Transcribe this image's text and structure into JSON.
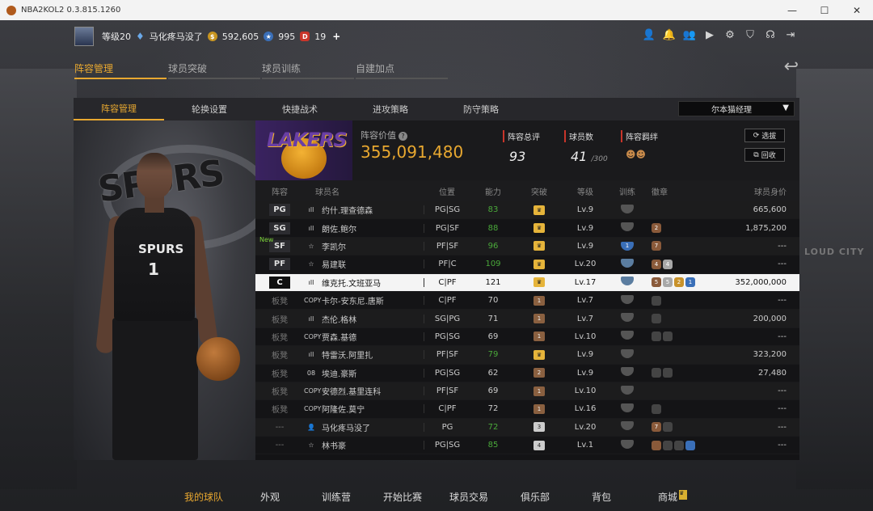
{
  "window": {
    "title": "NBA2KOL2 0.3.815.1260",
    "controls": [
      "—",
      "☐",
      "✕"
    ]
  },
  "topbar": {
    "level": "等级20",
    "username": "马化疼马没了",
    "gold": "592,605",
    "stars": "995",
    "tickets": "19",
    "plus": "+"
  },
  "main_tabs": [
    "阵容管理",
    "球员突破",
    "球员训练",
    "自建加点"
  ],
  "sub_tabs": [
    "阵容管理",
    "轮换设置",
    "快捷战术",
    "进攻策略",
    "防守策略"
  ],
  "manager_select": "尔本猫经理",
  "summary": {
    "lineup_value_label": "阵容价值",
    "lineup_value": "355,091,480",
    "rating_label": "阵容总评",
    "rating": "93",
    "players_label": "球员数",
    "players": "41",
    "players_max": "/300",
    "bond_label": "阵容羁绊",
    "btn_select": "选拔",
    "btn_recycle": "回收"
  },
  "columns": [
    "阵容",
    "球员名",
    "位置",
    "能力",
    "突破",
    "等级",
    "训练",
    "徽章",
    "球员身价"
  ],
  "rows": [
    {
      "slot": "PG",
      "tag": "",
      "icon": "ıll",
      "name": "约什.理查德森",
      "role": "PG|SG",
      "ovr": "83",
      "green": true,
      "brk": "gold",
      "brk_text": "♛",
      "lv": "Lv.9",
      "train": "",
      "badges": [],
      "val": "665,600",
      "hl": false
    },
    {
      "slot": "SG",
      "tag": "",
      "icon": "ıll",
      "name": "朗佐.鲍尔",
      "role": "PG|SF",
      "ovr": "88",
      "green": true,
      "brk": "gold",
      "brk_text": "♛",
      "lv": "Lv.9",
      "train": "",
      "badges": [
        "br:2"
      ],
      "val": "1,875,200",
      "hl": false
    },
    {
      "slot": "SF",
      "tag": "New",
      "icon": "☆",
      "name": "李凯尔",
      "role": "PF|SF",
      "ovr": "96",
      "green": true,
      "brk": "gold",
      "brk_text": "♛",
      "lv": "Lv.9",
      "train": "blue:1",
      "badges": [
        "br:7"
      ],
      "val": "---",
      "hl": false
    },
    {
      "slot": "PF",
      "tag": "",
      "icon": "☆",
      "name": "易建联",
      "role": "PF|C",
      "ovr": "109",
      "green": true,
      "brk": "gold",
      "brk_text": "♛",
      "lv": "Lv.20",
      "train": "steel:",
      "badges": [
        "br:4",
        "sv:4"
      ],
      "val": "---",
      "hl": false
    },
    {
      "slot": "C",
      "tag": "",
      "icon": "ıll",
      "name": "维克托.文班亚马",
      "role": "C|PF",
      "ovr": "121",
      "green": false,
      "brk": "gold",
      "brk_text": "♛",
      "lv": "Lv.17",
      "train": "steel:",
      "badges": [
        "br:5",
        "sv:5",
        "gd:2",
        "bl:1"
      ],
      "val": "352,000,000",
      "hl": true
    },
    {
      "slot": "板凳",
      "tag": "",
      "icon": "COPY",
      "name": "卡尔-安东尼.唐斯",
      "role": "C|PF",
      "ovr": "70",
      "green": false,
      "brk": "bronze",
      "brk_text": "1",
      "lv": "Lv.7",
      "train": "",
      "badges": [
        "gy:"
      ],
      "val": "---",
      "hl": false
    },
    {
      "slot": "板凳",
      "tag": "",
      "icon": "ıll",
      "name": "杰伦.格林",
      "role": "SG|PG",
      "ovr": "71",
      "green": false,
      "brk": "bronze",
      "brk_text": "1",
      "lv": "Lv.7",
      "train": "",
      "badges": [
        "gy:"
      ],
      "val": "200,000",
      "hl": false
    },
    {
      "slot": "板凳",
      "tag": "",
      "icon": "COPY",
      "name": "贾森.基德",
      "role": "PG|SG",
      "ovr": "69",
      "green": false,
      "brk": "bronze",
      "brk_text": "1",
      "lv": "Lv.10",
      "train": "",
      "badges": [
        "gy:",
        "gy:"
      ],
      "val": "---",
      "hl": false
    },
    {
      "slot": "板凳",
      "tag": "",
      "icon": "ıll",
      "name": "特雷沃.阿里扎",
      "role": "PF|SF",
      "ovr": "79",
      "green": true,
      "brk": "gold",
      "brk_text": "♛",
      "lv": "Lv.9",
      "train": "",
      "badges": [],
      "val": "323,200",
      "hl": false
    },
    {
      "slot": "板凳",
      "tag": "",
      "icon": "08",
      "name": "埃迪.豪斯",
      "role": "PG|SG",
      "ovr": "62",
      "green": false,
      "brk": "bronze",
      "brk_text": "2",
      "lv": "Lv.9",
      "train": "",
      "badges": [
        "gy:",
        "gy:"
      ],
      "val": "27,480",
      "hl": false
    },
    {
      "slot": "板凳",
      "tag": "",
      "icon": "COPY",
      "name": "安德烈.基里连科",
      "role": "PF|SF",
      "ovr": "69",
      "green": false,
      "brk": "bronze",
      "brk_text": "1",
      "lv": "Lv.10",
      "train": "",
      "badges": [],
      "val": "---",
      "hl": false
    },
    {
      "slot": "板凳",
      "tag": "",
      "icon": "COPY",
      "name": "阿隆佐.莫宁",
      "role": "C|PF",
      "ovr": "72",
      "green": false,
      "brk": "bronze",
      "brk_text": "1",
      "lv": "Lv.16",
      "train": "",
      "badges": [
        "gy:"
      ],
      "val": "---",
      "hl": false
    },
    {
      "slot": "---",
      "tag": "",
      "icon": "👤",
      "name": "马化疼马没了",
      "role": "PG",
      "ovr": "72",
      "green": true,
      "brk": "silver",
      "brk_text": "3",
      "lv": "Lv.20",
      "train": "",
      "badges": [
        "br:7",
        "gy:"
      ],
      "val": "---",
      "hl": false
    },
    {
      "slot": "---",
      "tag": "",
      "icon": "☆",
      "name": "林书豪",
      "role": "PG|SG",
      "ovr": "85",
      "green": true,
      "brk": "silver",
      "brk_text": "4",
      "lv": "Lv.1",
      "train": "",
      "badges": [
        "br:",
        "gy:",
        "gy:",
        "bl:"
      ],
      "val": "---",
      "hl": false
    }
  ],
  "bottom_nav": [
    "我的球队",
    "外观",
    "训练营",
    "开始比赛",
    "球员交易",
    "俱乐部",
    "背包",
    "商城"
  ],
  "player_art": {
    "jersey_text": "SPURS",
    "jersey_number": "1",
    "logo_text": "SPURS"
  },
  "arena_banner": "LOUD CITY",
  "colors": {
    "accent": "#e8a830",
    "rating_green": "#4aa93a"
  }
}
